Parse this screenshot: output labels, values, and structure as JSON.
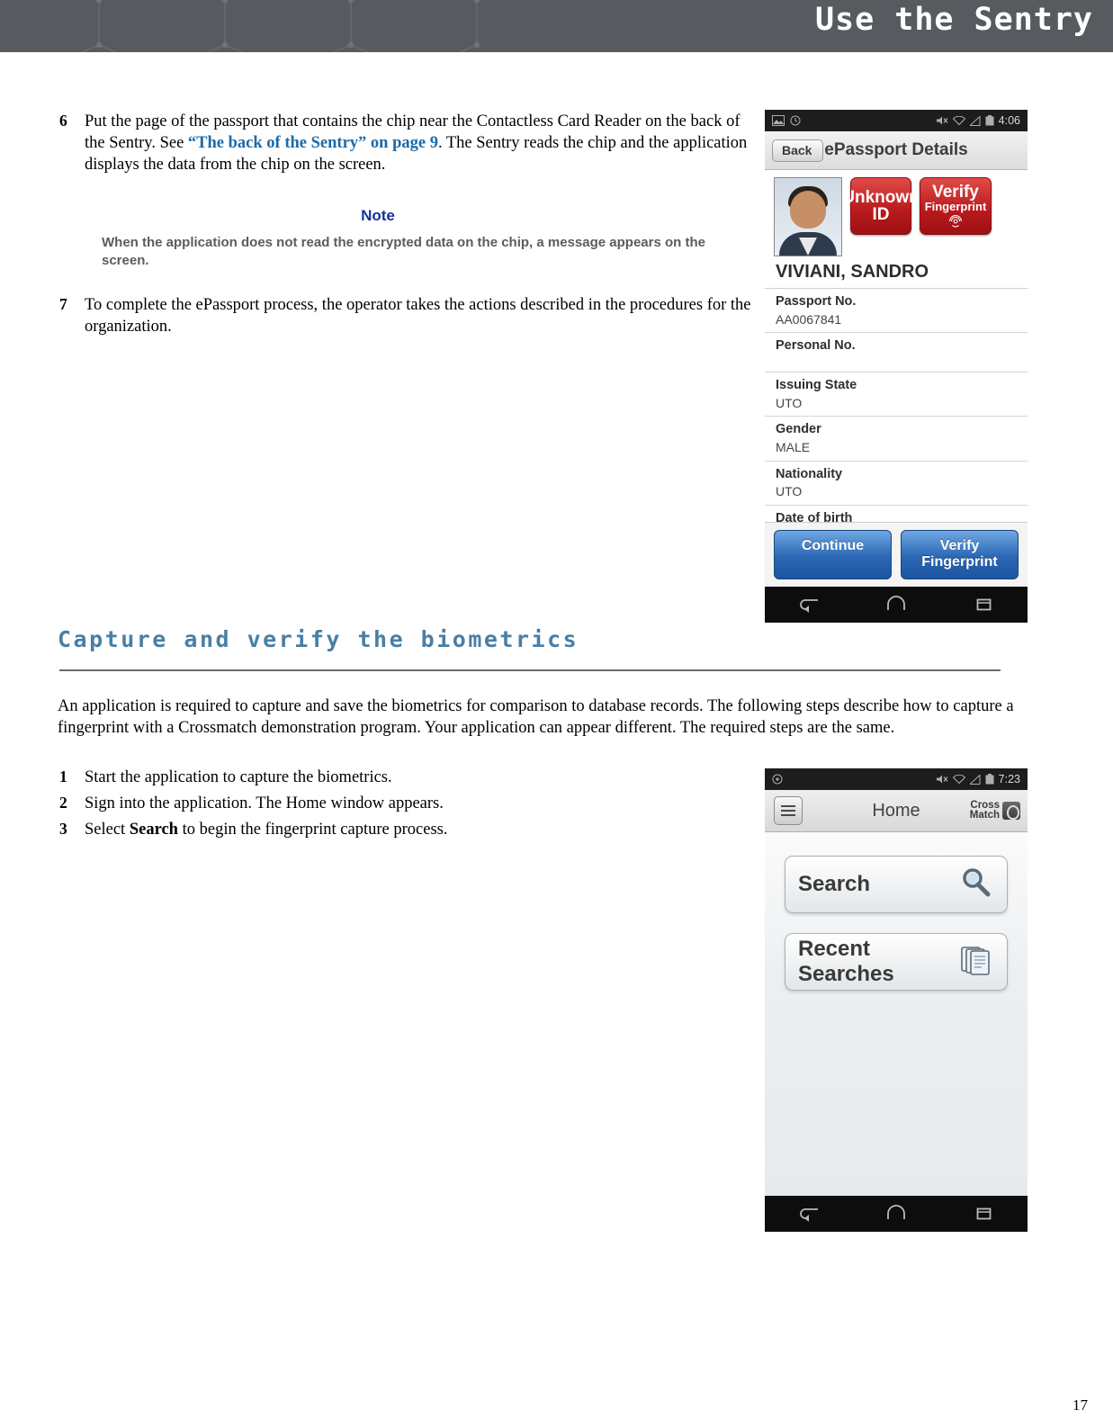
{
  "header": {
    "title": "Use the Sentry"
  },
  "page": {
    "number": "17"
  },
  "steps_top": [
    {
      "num": "6",
      "text_before": "Put the page of the passport that contains the chip near the Contactless Card Reader on the back of the Sentry. See ",
      "link": "“The back of the Sentry” on page 9",
      "text_after": ". The Sentry reads the chip and the application displays the data from the chip on the screen."
    },
    {
      "num": "7",
      "text_before": "To complete the ePassport process, the operator takes the actions described in the procedures for the organization.",
      "link": "",
      "text_after": ""
    }
  ],
  "note": {
    "title": "Note",
    "body": "When the application does not read the encrypted data on the chip, a message appears on the screen."
  },
  "section": {
    "heading": "Capture and verify the biometrics",
    "intro": "An application is required to capture and save the biometrics for comparison to database records. The following steps describe how to capture a fingerprint with a Crossmatch demonstration program. Your application can appear different. The required steps are the same."
  },
  "steps_bottom": [
    {
      "num": "1",
      "text": "Start the application to capture the biometrics."
    },
    {
      "num": "2",
      "text": "Sign into the application. The Home window appears."
    },
    {
      "num": "3",
      "text_before": "Select ",
      "bold": "Search",
      "text_after": " to begin the fingerprint capture process."
    }
  ],
  "phone_epassport": {
    "status": {
      "time": "4:06"
    },
    "app_bar": {
      "back_label": "Back",
      "title": "ePassport Details"
    },
    "buttons": {
      "unknown_id_line1": "Unknown",
      "unknown_id_line2": "ID",
      "verify_fp_line1": "Verify",
      "verify_fp_line2": "Fingerprint"
    },
    "name": "VIVIANI, SANDRO",
    "fields": [
      {
        "label": "Passport No.",
        "value": "AA0067841"
      },
      {
        "label": "Personal No.",
        "value": ""
      },
      {
        "label": "Issuing State",
        "value": "UTO"
      },
      {
        "label": "Gender",
        "value": "MALE"
      },
      {
        "label": "Nationality",
        "value": "UTO"
      },
      {
        "label": "Date of birth",
        "value": ""
      }
    ],
    "actions": {
      "continue": "Continue",
      "verify": "Verify Fingerprint"
    }
  },
  "phone_home": {
    "status": {
      "time": "7:23"
    },
    "app_bar": {
      "title": "Home",
      "logo_line1": "Cross",
      "logo_line2": "Match"
    },
    "buttons": [
      {
        "label": "Search",
        "icon": "magnifier-icon"
      },
      {
        "label": "Recent Searches",
        "icon": "documents-icon"
      }
    ]
  },
  "colors": {
    "header_band": "#575b60",
    "link": "#1c6aa8",
    "section_heading": "#4a7fa5",
    "note_title": "#14329b",
    "red_button": "#b8191c",
    "blue_button": "#2a67b4"
  }
}
